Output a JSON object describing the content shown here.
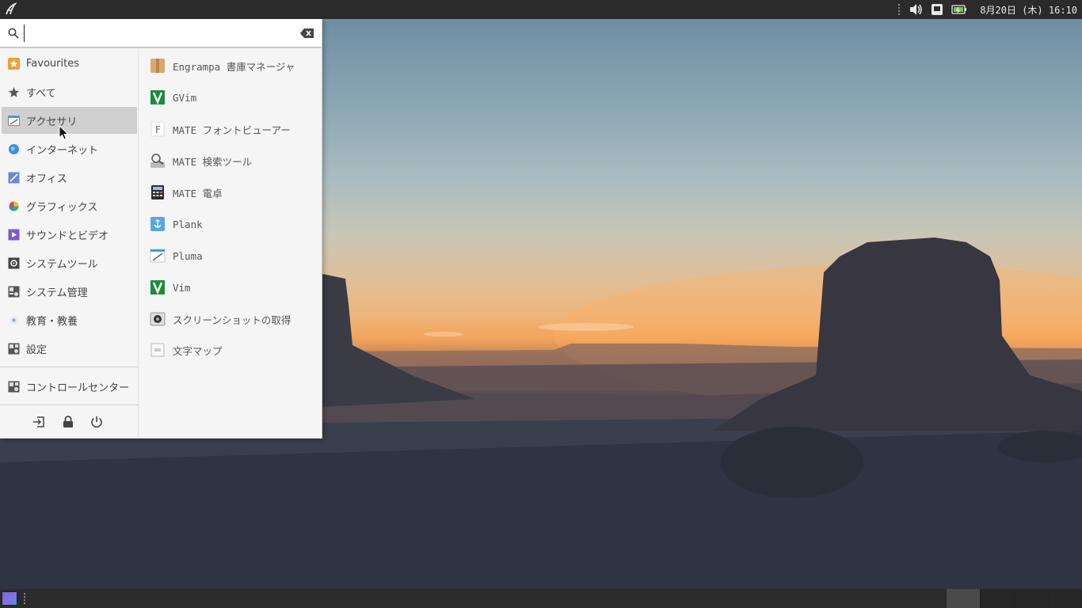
{
  "top_panel": {
    "clock": "8月20日 (木) 16:10",
    "icons": [
      "mate-menu-icon",
      "volume-icon",
      "network-icon",
      "battery-icon"
    ]
  },
  "search": {
    "value": "",
    "placeholder": ""
  },
  "categories": [
    {
      "label": "Favourites",
      "icon": "star-icon"
    },
    {
      "label": "すべて",
      "icon": "star-icon"
    },
    {
      "label": "アクセサリ",
      "icon": "accessories-icon",
      "active": true
    },
    {
      "label": "インターネット",
      "icon": "globe-icon"
    },
    {
      "label": "オフィス",
      "icon": "office-icon"
    },
    {
      "label": "グラフィックス",
      "icon": "graphics-icon"
    },
    {
      "label": "サウンドとビデオ",
      "icon": "multimedia-icon"
    },
    {
      "label": "システムツール",
      "icon": "system-tools-icon"
    },
    {
      "label": "システム管理",
      "icon": "admin-icon"
    },
    {
      "label": "教育・教養",
      "icon": "education-icon"
    },
    {
      "label": "設定",
      "icon": "settings-icon"
    }
  ],
  "control_center": {
    "label": "コントロールセンター",
    "icon": "control-center-icon"
  },
  "session_buttons": [
    "logout-icon",
    "lock-icon",
    "power-icon"
  ],
  "apps": [
    {
      "label": "Engrampa 書庫マネージャ",
      "icon": "archive-icon"
    },
    {
      "label": "GVim",
      "icon": "vim-icon"
    },
    {
      "label": "MATE フォントビューアー",
      "icon": "font-icon"
    },
    {
      "label": "MATE 検索ツール",
      "icon": "search-tool-icon"
    },
    {
      "label": "MATE 電卓",
      "icon": "calculator-icon"
    },
    {
      "label": "Plank",
      "icon": "plank-icon"
    },
    {
      "label": "Pluma",
      "icon": "pluma-icon"
    },
    {
      "label": "Vim",
      "icon": "vim-icon"
    },
    {
      "label": "スクリーンショットの取得",
      "icon": "screenshot-icon"
    },
    {
      "label": "文字マップ",
      "icon": "charmap-icon"
    }
  ],
  "colors": {
    "panel": "#2b2b2b",
    "menu_bg": "#f5f5f5",
    "active_row": "#cfcfcf"
  }
}
